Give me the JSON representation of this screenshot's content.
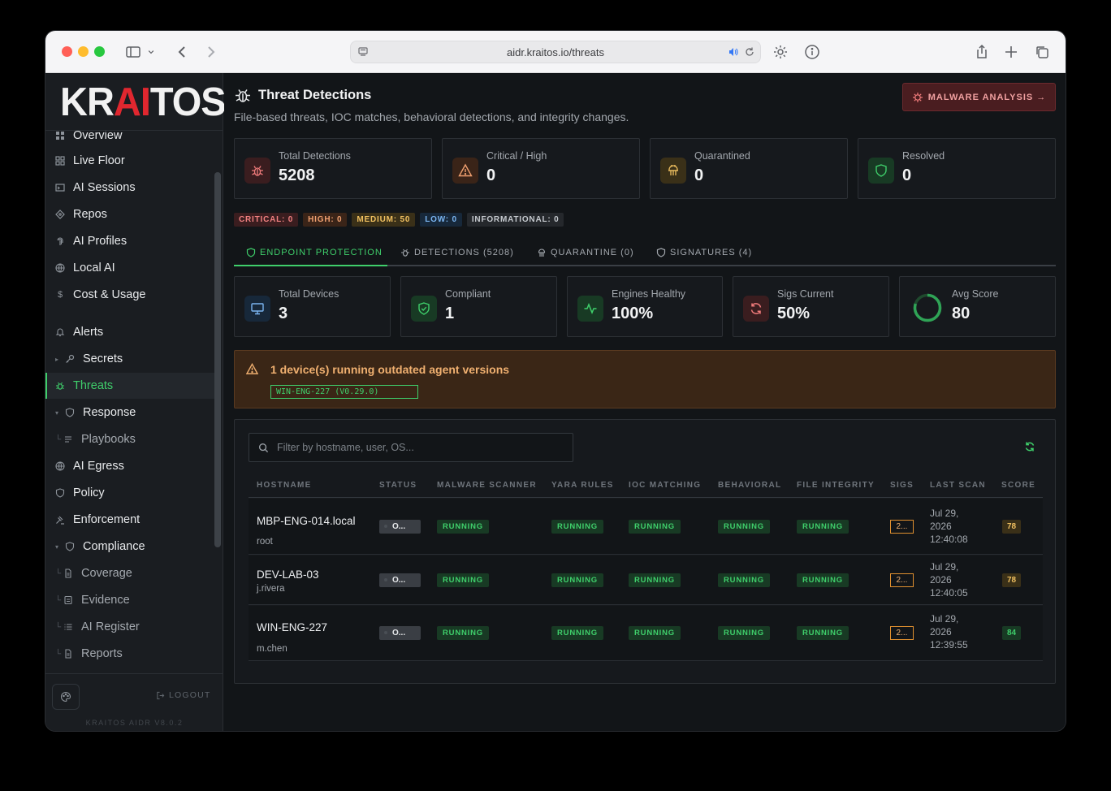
{
  "browser": {
    "url": "aidr.kraitos.io/threats"
  },
  "sidebar": {
    "logo": {
      "pre": "KR",
      "accent": "AI",
      "post": "TOS"
    },
    "items": [
      {
        "label": "Overview",
        "icon": "grid-icon"
      },
      {
        "label": "Live Floor",
        "icon": "grid-icon"
      },
      {
        "label": "AI Sessions",
        "icon": "terminal-icon"
      },
      {
        "label": "Repos",
        "icon": "git-icon"
      },
      {
        "label": "AI Profiles",
        "icon": "fingerprint-icon"
      },
      {
        "label": "Local AI",
        "icon": "chip-icon"
      },
      {
        "label": "Cost & Usage",
        "icon": "dollar-icon"
      },
      {
        "label": "Alerts",
        "icon": "bell-icon"
      },
      {
        "label": "Secrets",
        "icon": "key-icon"
      },
      {
        "label": "Threats",
        "icon": "bug-icon"
      },
      {
        "label": "Response",
        "icon": "shield-icon"
      },
      {
        "label": "Playbooks",
        "icon": "playbook-icon"
      },
      {
        "label": "AI Egress",
        "icon": "globe-icon"
      },
      {
        "label": "Policy",
        "icon": "shield-icon"
      },
      {
        "label": "Enforcement",
        "icon": "gavel-icon"
      },
      {
        "label": "Compliance",
        "icon": "shield-icon"
      },
      {
        "label": "Coverage",
        "icon": "doc-icon"
      },
      {
        "label": "Evidence",
        "icon": "doc-icon"
      },
      {
        "label": "AI Register",
        "icon": "list-icon"
      },
      {
        "label": "Reports",
        "icon": "doc-icon"
      }
    ],
    "logout": "LOGOUT",
    "version": "KRAITOS AIDR V8.0.2"
  },
  "header": {
    "title": "Threat Detections",
    "subtitle": "File-based threats, IOC matches, behavioral detections, and integrity changes.",
    "malware_button": "MALWARE ANALYSIS →"
  },
  "stats": [
    {
      "label": "Total Detections",
      "value": "5208"
    },
    {
      "label": "Critical / High",
      "value": "0"
    },
    {
      "label": "Quarantined",
      "value": "0"
    },
    {
      "label": "Resolved",
      "value": "0"
    }
  ],
  "severity": [
    {
      "label": "CRITICAL: 0"
    },
    {
      "label": "HIGH: 0"
    },
    {
      "label": "MEDIUM: 50"
    },
    {
      "label": "LOW: 0"
    },
    {
      "label": "INFORMATIONAL: 0"
    }
  ],
  "tabs": [
    {
      "label": "ENDPOINT PROTECTION"
    },
    {
      "label": "DETECTIONS (5208)"
    },
    {
      "label": "QUARANTINE (0)"
    },
    {
      "label": "SIGNATURES (4)"
    }
  ],
  "endpoint_stats": [
    {
      "label": "Total Devices",
      "value": "3"
    },
    {
      "label": "Compliant",
      "value": "1"
    },
    {
      "label": "Engines Healthy",
      "value": "100%"
    },
    {
      "label": "Sigs Current",
      "value": "50%"
    },
    {
      "label": "Avg Score",
      "value": "80",
      "ring_fraction": 0.8
    }
  ],
  "alert": {
    "title": "1 device(s) running outdated agent versions",
    "chip": "WIN-ENG-227 (V0.29.0)"
  },
  "filter": {
    "placeholder": "Filter by hostname, user, OS..."
  },
  "table": {
    "columns": [
      "HOSTNAME",
      "STATUS",
      "MALWARE SCANNER",
      "YARA RULES",
      "IOC MATCHING",
      "BEHAVIORAL",
      "FILE INTEGRITY",
      "SIGS",
      "LAST SCAN",
      "SCORE"
    ],
    "rows": [
      {
        "hostname": "MBP-ENG-014.local",
        "user": "root",
        "status": "O...",
        "malware": "RUNNING",
        "yara": "RUNNING",
        "ioc": "RUNNING",
        "behavioral": "RUNNING",
        "integrity": "RUNNING",
        "sigs": "2...",
        "scan_l1": "Jul 29,",
        "scan_l2": "2026",
        "scan_l3": "12:40:08",
        "score": "78"
      },
      {
        "hostname": "DEV-LAB-03",
        "user": "j.rivera",
        "status": "O...",
        "malware": "RUNNING",
        "yara": "RUNNING",
        "ioc": "RUNNING",
        "behavioral": "RUNNING",
        "integrity": "RUNNING",
        "sigs": "2...",
        "scan_l1": "Jul 29,",
        "scan_l2": "2026",
        "scan_l3": "12:40:05",
        "score": "78"
      },
      {
        "hostname": "WIN-ENG-227",
        "user": "m.chen",
        "status": "O...",
        "malware": "RUNNING",
        "yara": "RUNNING",
        "ioc": "RUNNING",
        "behavioral": "RUNNING",
        "integrity": "RUNNING",
        "sigs": "2...",
        "scan_l1": "Jul 29,",
        "scan_l2": "2026",
        "scan_l3": "12:39:55",
        "score": "84"
      }
    ]
  }
}
